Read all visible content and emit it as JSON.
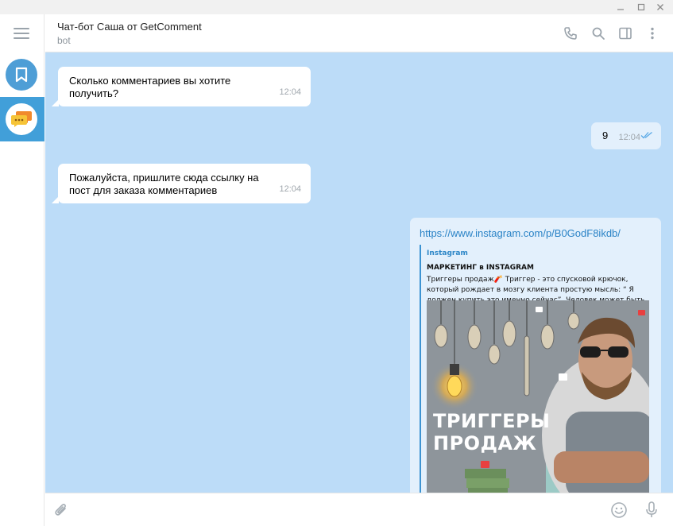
{
  "window": {
    "minimize_icon": "minimize-icon",
    "maximize_icon": "maximize-icon",
    "close_icon": "close-icon"
  },
  "sidebar": {
    "menu_icon": "hamburger-menu-icon",
    "items": [
      {
        "name": "saved-messages",
        "icon": "bookmark-icon",
        "color": "#4e9ed6",
        "active": false
      },
      {
        "name": "chat-bot-sasha",
        "icon": "chat-bubbles-icon",
        "color": "#419fd9",
        "active": true
      }
    ]
  },
  "header": {
    "title": "Чат-бот Саша от GetComment",
    "status": "bot",
    "icons": [
      "phone-icon",
      "search-icon",
      "sidebar-toggle-icon",
      "more-vertical-icon"
    ]
  },
  "colors": {
    "chat_background": "#bcdcf8",
    "accent": "#419fd9",
    "link": "#2a83c6",
    "read_check": "#5aa9e6"
  },
  "messages": [
    {
      "direction": "in",
      "text": "Сколько комментариев вы хотите\nполучить?",
      "time": "12:04"
    },
    {
      "direction": "out",
      "text": "9",
      "time": "12:04",
      "status": "read"
    },
    {
      "direction": "in",
      "text": "Пожалуйста, пришлите сюда ссылку на\nпост для заказа комментариев",
      "time": "12:04"
    },
    {
      "direction": "out",
      "text": "https://www.instagram.com/p/B0GodF8ikdb/",
      "preview": {
        "site": "Instagram",
        "title": "МАРКЕТИНГ в INSTAGRAM",
        "description": "Триггеры продаж🧨    Триггер - это спусковой крючок, который рождает в мозгу клиента простую мысль: “ Я должен купить это именно сейчас”. Человек может быть подписан н…",
        "image_headline": "ТРИГГЕРЫ\nПРОДАЖ"
      }
    }
  ],
  "composer": {
    "placeholder": "",
    "attach_icon": "paperclip-icon",
    "emoji_icon": "emoji-icon",
    "mic_icon": "microphone-icon"
  }
}
